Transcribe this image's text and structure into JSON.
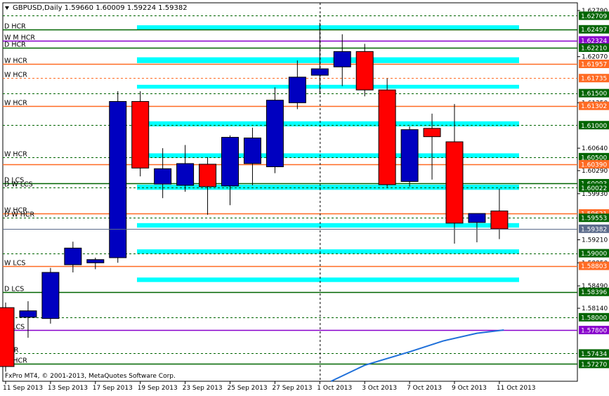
{
  "header": {
    "menu_icon": "triangle-down-icon",
    "title": "GBPUSD,Daily  1.59660 1.60009 1.59224 1.59382"
  },
  "footer": {
    "copyright": "FxPro MT4, © 2001-2013, MetaQuotes Software Corp."
  },
  "colors": {
    "bull": "#0000c0",
    "bear": "#ff0000",
    "zone": "#00ffff",
    "green": "#006400",
    "orange": "#ff6a22",
    "purple": "#8800cc",
    "ma": "#1e6fd9",
    "current": "#5a6a8a",
    "grid": "#000000"
  },
  "chart_data": {
    "type": "candlestick",
    "symbol": "GBPUSD",
    "timeframe": "Daily",
    "ylim": [
      1.57,
      1.629
    ],
    "x_labels": [
      "11 Sep 2013",
      "13 Sep 2013",
      "17 Sep 2013",
      "19 Sep 2013",
      "23 Sep 2013",
      "25 Sep 2013",
      "27 Sep 2013",
      "1 Oct 2013",
      "3 Oct 2013",
      "7 Oct 2013",
      "9 Oct 2013",
      "11 Oct 2013"
    ],
    "candles": [
      {
        "o": 1.5815,
        "h": 1.5823,
        "l": 1.5715,
        "c": 1.5723
      },
      {
        "o": 1.58,
        "h": 1.5825,
        "l": 1.5768,
        "c": 1.581
      },
      {
        "o": 1.5798,
        "h": 1.5877,
        "l": 1.579,
        "c": 1.587
      },
      {
        "o": 1.5882,
        "h": 1.5918,
        "l": 1.587,
        "c": 1.5908
      },
      {
        "o": 1.5885,
        "h": 1.5893,
        "l": 1.5875,
        "c": 1.589
      },
      {
        "o": 1.5893,
        "h": 1.6153,
        "l": 1.5885,
        "c": 1.6137
      },
      {
        "o": 1.6137,
        "h": 1.6153,
        "l": 1.602,
        "c": 1.6033
      },
      {
        "o": 1.6008,
        "h": 1.6064,
        "l": 1.5986,
        "c": 1.6032
      },
      {
        "o": 1.6006,
        "h": 1.6069,
        "l": 1.5996,
        "c": 1.604
      },
      {
        "o": 1.6039,
        "h": 1.605,
        "l": 1.596,
        "c": 1.6004
      },
      {
        "o": 1.6005,
        "h": 1.6084,
        "l": 1.5975,
        "c": 1.6081
      },
      {
        "o": 1.604,
        "h": 1.6096,
        "l": 1.6006,
        "c": 1.608
      },
      {
        "o": 1.6035,
        "h": 1.6159,
        "l": 1.6025,
        "c": 1.6139
      },
      {
        "o": 1.6135,
        "h": 1.6201,
        "l": 1.6125,
        "c": 1.6175
      },
      {
        "o": 1.6178,
        "h": 1.626,
        "l": 1.615,
        "c": 1.6188
      },
      {
        "o": 1.6191,
        "h": 1.6242,
        "l": 1.6161,
        "c": 1.6215
      },
      {
        "o": 1.6215,
        "h": 1.6227,
        "l": 1.6145,
        "c": 1.6155
      },
      {
        "o": 1.6155,
        "h": 1.6173,
        "l": 1.6003,
        "c": 1.6007
      },
      {
        "o": 1.6012,
        "h": 1.6098,
        "l": 1.6004,
        "c": 1.6093
      },
      {
        "o": 1.6095,
        "h": 1.6118,
        "l": 1.6015,
        "c": 1.6082
      },
      {
        "o": 1.6074,
        "h": 1.6133,
        "l": 1.5915,
        "c": 1.5947
      },
      {
        "o": 1.5948,
        "h": 1.5962,
        "l": 1.5917,
        "c": 1.5962
      },
      {
        "o": 1.5966,
        "h": 1.6001,
        "l": 1.5922,
        "c": 1.5938
      }
    ],
    "zones": [
      {
        "top": 1.6256,
        "bottom": 1.6249
      },
      {
        "top": 1.6206,
        "bottom": 1.6197
      },
      {
        "top": 1.6163,
        "bottom": 1.6157
      },
      {
        "top": 1.6106,
        "bottom": 1.6098
      },
      {
        "top": 1.6056,
        "bottom": 1.6049
      },
      {
        "top": 1.6007,
        "bottom": 1.5999
      },
      {
        "top": 1.5947,
        "bottom": 1.594
      },
      {
        "top": 1.5906,
        "bottom": 1.5899
      },
      {
        "top": 1.5862,
        "bottom": 1.5855
      }
    ],
    "levels": [
      {
        "price": 1.62709,
        "color": "#006400",
        "text": "",
        "axis": "1.62709",
        "badge": "green"
      },
      {
        "price": 1.62497,
        "color": "#006400",
        "text": "D     HCR",
        "axis": "1.62497",
        "badge": "green"
      },
      {
        "price": 1.62324,
        "color": "#8800cc",
        "text": "W  M HCR",
        "axis": "1.62324",
        "badge": "purple"
      },
      {
        "price": 1.6221,
        "color": "#006400",
        "text": "D     HCR",
        "axis": "1.62210",
        "badge": "green"
      },
      {
        "price": 1.61957,
        "color": "#ff6a22",
        "text": "W     HCR",
        "axis": "1.61957",
        "badge": "orange"
      },
      {
        "price": 1.61735,
        "color": "#ff6a22",
        "text": "W     HCR",
        "axis": "1.61735",
        "badge": "orange"
      },
      {
        "price": 1.615,
        "color": "#006400",
        "text": "",
        "axis": "1.61500",
        "badge": "green"
      },
      {
        "price": 1.61302,
        "color": "#ff6a22",
        "text": "W     HCR",
        "axis": "1.61302",
        "badge": "orange"
      },
      {
        "price": 1.61,
        "color": "#006400",
        "text": "",
        "axis": "1.61000",
        "badge": "green"
      },
      {
        "price": 1.605,
        "color": "#006400",
        "text": "W     HCR",
        "axis": "1.60500",
        "badge": "green"
      },
      {
        "price": 1.6039,
        "color": "#ff6a22",
        "text": "",
        "axis": "1.60390",
        "badge": "orange"
      },
      {
        "price": 1.60093,
        "color": "#006400",
        "text": "D     LCS",
        "axis": "1.60093",
        "badge": "green"
      },
      {
        "price": 1.60022,
        "color": "#006400",
        "text": "D W  LCS",
        "axis": "1.60022",
        "badge": "green"
      },
      {
        "price": 1.59621,
        "color": "#ff6a22",
        "text": "W     HCR",
        "axis": "1.59621",
        "badge": "orange"
      },
      {
        "price": 1.59553,
        "color": "#006400",
        "text": "D W  HCR",
        "axis": "1.59553",
        "badge": "green"
      },
      {
        "price": 1.59,
        "color": "#006400",
        "text": "",
        "axis": "1.59000",
        "badge": "green"
      },
      {
        "price": 1.58803,
        "color": "#ff6a22",
        "text": "W     LCS",
        "axis": "1.58803",
        "badge": "orange"
      },
      {
        "price": 1.58396,
        "color": "#006400",
        "text": "D     LCS",
        "axis": "1.58396",
        "badge": "green"
      },
      {
        "price": 1.58,
        "color": "#006400",
        "text": "",
        "axis": "1.58000",
        "badge": "green"
      },
      {
        "price": 1.578,
        "color": "#8800cc",
        "text": "     M LCS",
        "axis": "1.57800",
        "badge": "purple"
      },
      {
        "price": 1.57434,
        "color": "#006400",
        "text": "     HCR",
        "axis": "1.57434",
        "badge": "green"
      },
      {
        "price": 1.5727,
        "color": "#006400",
        "text": "W    HCR",
        "axis": "1.57270",
        "badge": "green"
      }
    ],
    "axis_ticks": [
      "1.62790",
      "1.62070",
      "1.61350",
      "1.60640",
      "1.60290",
      "1.59930",
      "1.59210",
      "1.58850",
      "1.58490",
      "1.58140"
    ],
    "ma_line": [
      {
        "bar": 14.5,
        "price": 1.57
      },
      {
        "bar": 16,
        "price": 1.5725
      },
      {
        "bar": 18,
        "price": 1.5746
      },
      {
        "bar": 19.5,
        "price": 1.5763
      },
      {
        "bar": 21,
        "price": 1.5775
      },
      {
        "bar": 22.2,
        "price": 1.578
      }
    ],
    "current_price": {
      "value": 1.59382,
      "label": "1.59382"
    },
    "period_separator_bar": 14,
    "annotations_top_left": "D"
  }
}
